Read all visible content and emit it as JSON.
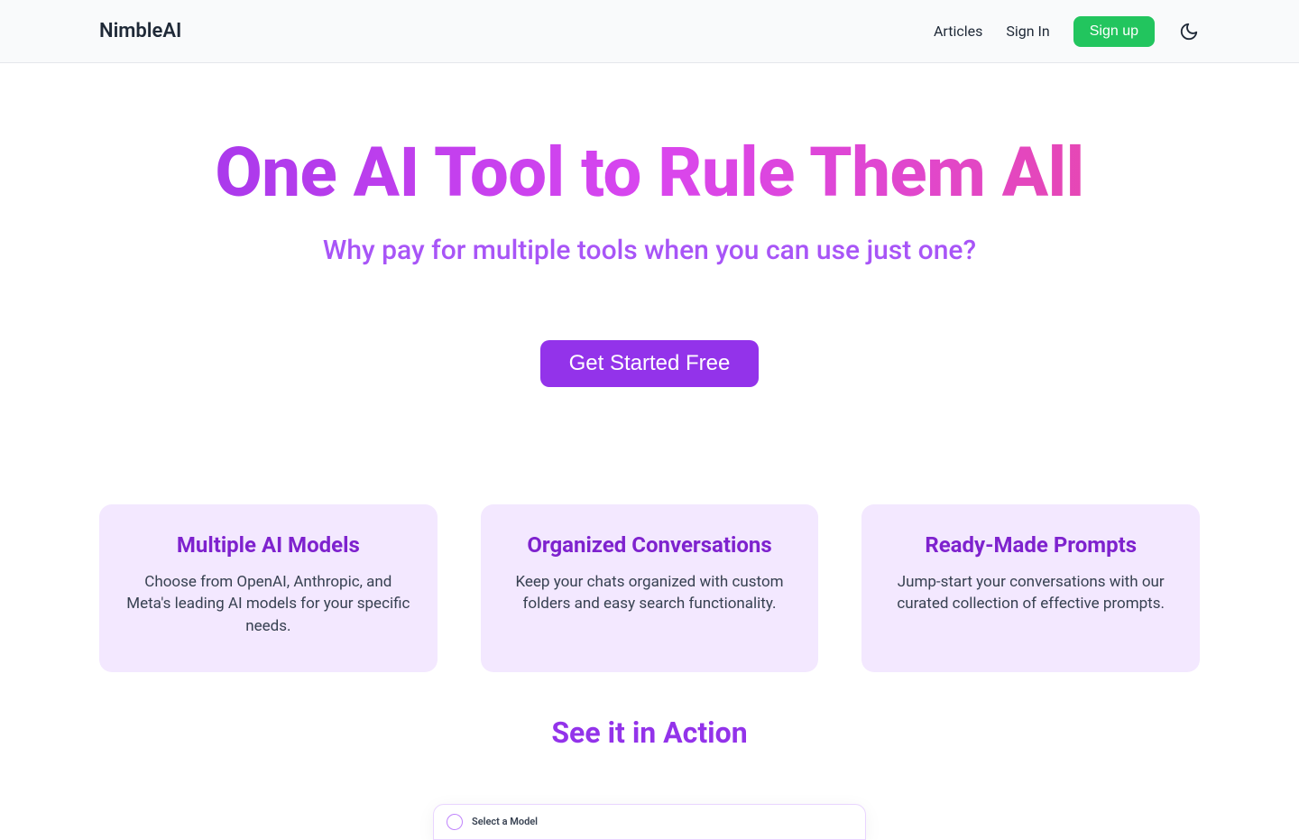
{
  "header": {
    "logo": "NimbleAI",
    "nav": {
      "articles": "Articles",
      "signin": "Sign In",
      "signup": "Sign up"
    }
  },
  "hero": {
    "title": "One AI Tool to Rule Them All",
    "subtitle": "Why pay for multiple tools when you can use just one?",
    "cta": "Get Started Free"
  },
  "features": [
    {
      "title": "Multiple AI Models",
      "desc": "Choose from OpenAI, Anthropic, and Meta's leading AI models for your specific needs."
    },
    {
      "title": "Organized Conversations",
      "desc": "Keep your chats organized with custom folders and easy search functionality."
    },
    {
      "title": "Ready-Made Prompts",
      "desc": "Jump-start your conversations with our curated collection of effective prompts."
    }
  ],
  "see_it": "See it in Action",
  "preview": {
    "label": "Select a Model"
  }
}
